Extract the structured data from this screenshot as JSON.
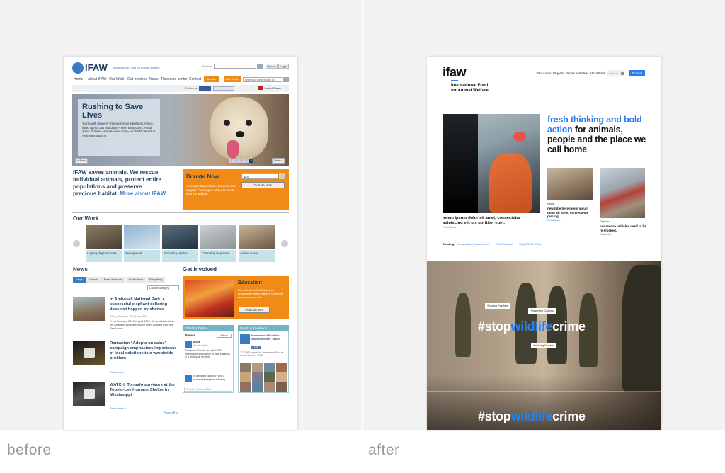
{
  "labels": {
    "before": "before",
    "after": "after"
  },
  "old_site": {
    "logo": "IFAW",
    "tagline": "International Fund for Animal Welfare",
    "search_label": "Search",
    "signup": "Sign up",
    "login": "Login",
    "nav": [
      "Home",
      "About IFAW",
      "Our Work",
      "Get Involved",
      "News",
      "Resource centre",
      "Contact"
    ],
    "donate_btn": "Donate",
    "action_btn": "Take Action",
    "email_placeholder": "Enter your email to sign up",
    "follow_us": "Follow us:",
    "region": "United States",
    "hero": {
      "title": "Rushing to Save Lives",
      "body": "You're with us every time we rescue elephants, rhinos, lions, tigers, cats and dogs -- even baby otters. Read about all these animals—and more—in IFAW's World of Animals magazine.",
      "prev": "« Prev",
      "next": "Next »",
      "pager": [
        "1",
        "2",
        "3",
        "4",
        "5"
      ]
    },
    "intro_strong": "IFAW saves animals.",
    "intro_text": "We rescue individual animals, protect entire populations and preserve precious habitat.",
    "intro_link": "More about IFAW",
    "donate_box": {
      "title": "Donate Now",
      "text": "Your work depends on your generous support. Please give what you can to help the animals",
      "amount": "$25",
      "button": "Donate Now"
    },
    "our_work_title": "Our Work",
    "our_work": [
      "Helping dogs and cats",
      "Saving seals",
      "Defending whales",
      "Protecting elephants",
      "Animal rescue"
    ],
    "news_title": "News",
    "news_tabs": [
      "Blogs",
      "Videos",
      "Press Releases",
      "Publications",
      "Everything"
    ],
    "news_select": "Choose category",
    "news": [
      {
        "title": "In Amboseli National Park, a successful elephant collaring does not happen by chance",
        "meta": "Friday, February 2013 | Jane Ellis",
        "excerpt": "From February 2013 to April 2014, 12 elephants within the Amboseli ecosystem have been collared by IFAW... Read more"
      },
      {
        "title": "Romanian “Adopta un caine” campaign emphasizes importance of local solutions to a worldwide problem",
        "meta": "",
        "excerpt": "Read more »"
      },
      {
        "title": "WATCH: Tornado survivors at the Tupelo-Lee Humane Shelter in Mississippi",
        "meta": "",
        "excerpt": "Read more »"
      }
    ],
    "see_all": "See all »",
    "get_involved_title": "Get Involved",
    "education": {
      "title": "Education",
      "text": "Our Animal Action Education programme helps children learn and care about animals",
      "button": "Find out more"
    },
    "twitter": {
      "header": "IFAW on Twitter",
      "tweets": "Tweets",
      "follow": "Follow",
      "handle": "IFAW",
      "at": "@action4ifaw",
      "tweet1": "Romanian “Adopta un caine”: PSA emphasizes importance of local solutions to a worldwide problem",
      "tweet2": "In Amboseli National Park, a successful elephant collaring",
      "compose": "Tweet to @action4ifaw"
    },
    "facebook": {
      "header": "IFAW on Facebook",
      "page": "International Fund for Animal Welfare - IFAW",
      "like": "Like",
      "fans": "3,273,992 people like International Fund for Animal Welfare - IFAW"
    }
  },
  "new_site": {
    "logo": "ifaw",
    "logo_sub": "International Fund for Animal Welfare",
    "nav": [
      "Take Action",
      "Projects",
      "People and Ideas",
      "About IFAW"
    ],
    "search_placeholder": "Search",
    "donate": "Donate",
    "headline_blue": "fresh thinking and bold action",
    "headline_black": "for animals, people and the place we call home",
    "feature_caption": "lorem ipsum dolor sit amet, consectetur adipiscing elit uis porttitor eget.",
    "feature_link": "Read More",
    "card1": {
      "tag": "News",
      "text": "newstitle here lorem ipsum dolor sit amet, consectetur piscing",
      "link": "Read More"
    },
    "card2": {
      "tag": "Opinion",
      "text": "our rescue vehicles need to be re-stocked.",
      "link": "Read More"
    },
    "trending_label": "Trending:",
    "trending": [
      "Conservation Partnerships",
      "Rhino Trauma",
      "Stop Wildlife Crime"
    ],
    "hashtag_pre": "#stop",
    "hashtag_mid": "wildlife",
    "hashtag_post": "crime",
    "tags": [
      "Stopping Poachers",
      "Preventing Collaring",
      "Reducing Demand"
    ]
  },
  "colors": {
    "old_navy": "#1f3f5f",
    "old_link": "#3a7cc0",
    "old_orange": "#f28a17",
    "new_blue": "#2a7fea",
    "new_black": "#111111"
  }
}
